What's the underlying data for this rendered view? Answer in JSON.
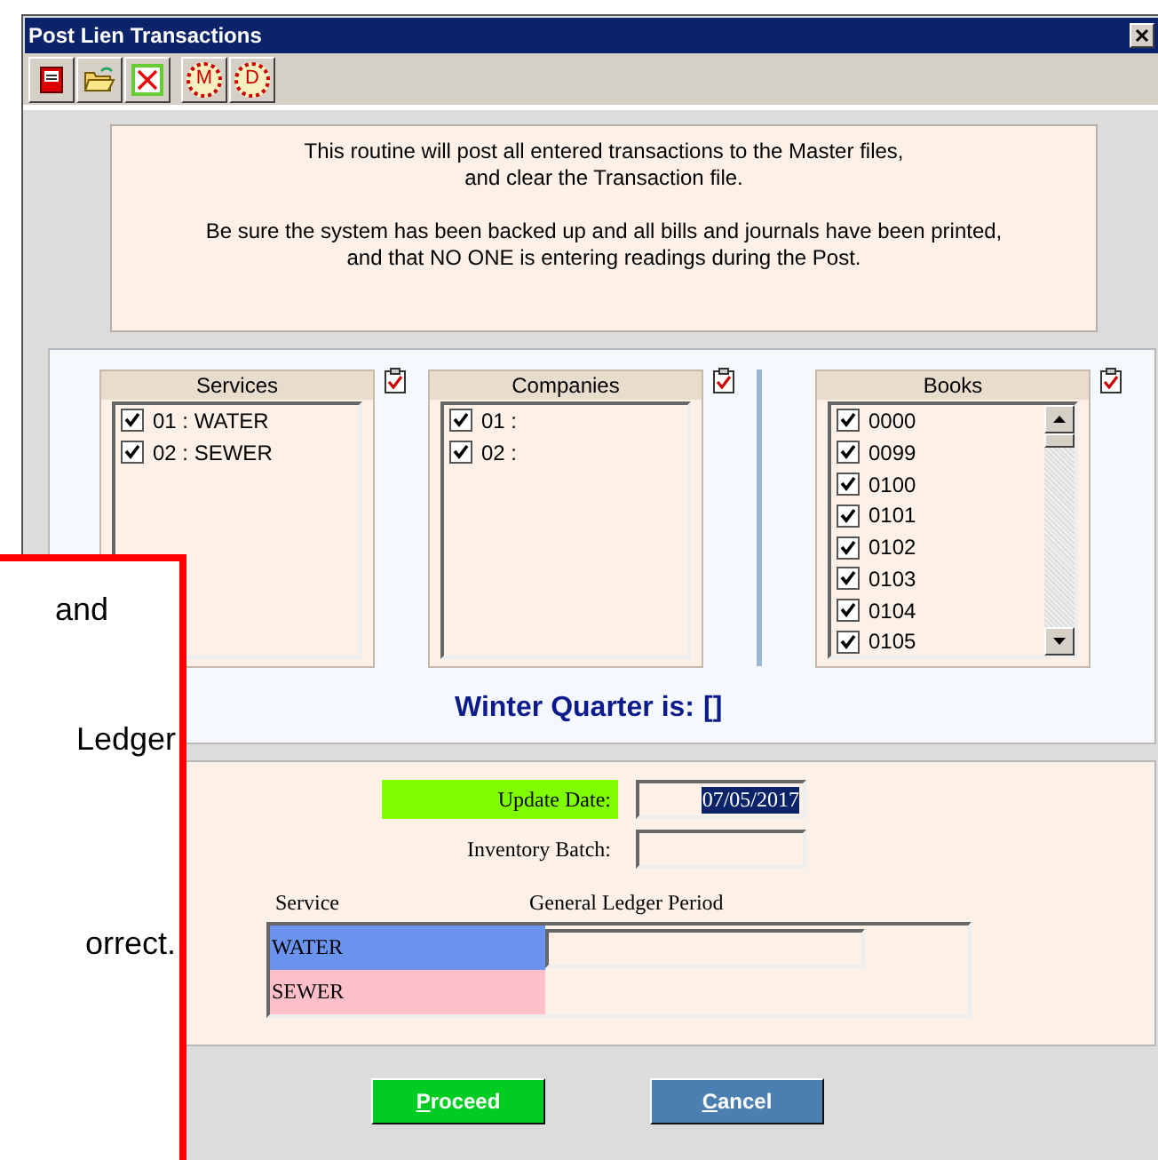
{
  "window": {
    "title": "Post Lien Transactions"
  },
  "toolbar": [
    {
      "kind": "save"
    },
    {
      "kind": "open"
    },
    {
      "kind": "delete"
    },
    {
      "kind": "letter",
      "glyph": "M"
    },
    {
      "kind": "letter",
      "glyph": "D"
    }
  ],
  "notice": [
    [
      "This routine will post all entered transactions to the Master files,",
      "and clear the Transaction file."
    ],
    [
      "Be sure the system has been backed up and all bills and journals have been printed,",
      "and that NO ONE is entering readings during the Post."
    ]
  ],
  "lists": [
    {
      "title": "Services",
      "scrollbar": false,
      "items": [
        {
          "label": "01 : WATER",
          "checked": true
        },
        {
          "label": "02 : SEWER",
          "checked": true
        }
      ]
    },
    {
      "title": "Companies",
      "scrollbar": false,
      "items": [
        {
          "label": "01 :",
          "checked": true
        },
        {
          "label": "02 :",
          "checked": true
        }
      ]
    },
    {
      "title": "Books",
      "scrollbar": true,
      "items": [
        {
          "label": "0000",
          "checked": true
        },
        {
          "label": "0099",
          "checked": true
        },
        {
          "label": "0100",
          "checked": true
        },
        {
          "label": "0101",
          "checked": true
        },
        {
          "label": "0102",
          "checked": true
        },
        {
          "label": "0103",
          "checked": true
        },
        {
          "label": "0104",
          "checked": true
        },
        {
          "label": "0105",
          "checked": true
        }
      ]
    }
  ],
  "winter_quarter": {
    "label": "Winter Quarter is:",
    "value": "[]"
  },
  "update_date": {
    "label": "Update Date:",
    "value": "07/05/2017"
  },
  "inventory_batch": {
    "label": "Inventory Batch:"
  },
  "gl_table": {
    "columns": [
      "Service",
      "General Ledger Period"
    ],
    "rows": [
      {
        "service": "WATER",
        "color": "#6a93ee"
      },
      {
        "service": "SEWER",
        "color": "#ffc0cb"
      }
    ]
  },
  "buttons": [
    {
      "label": "Proceed",
      "kind": "proceed"
    },
    {
      "label": "Cancel",
      "kind": "cancel"
    }
  ],
  "callout": {
    "lines": [
      "and",
      "Ledger",
      "orrect."
    ]
  }
}
